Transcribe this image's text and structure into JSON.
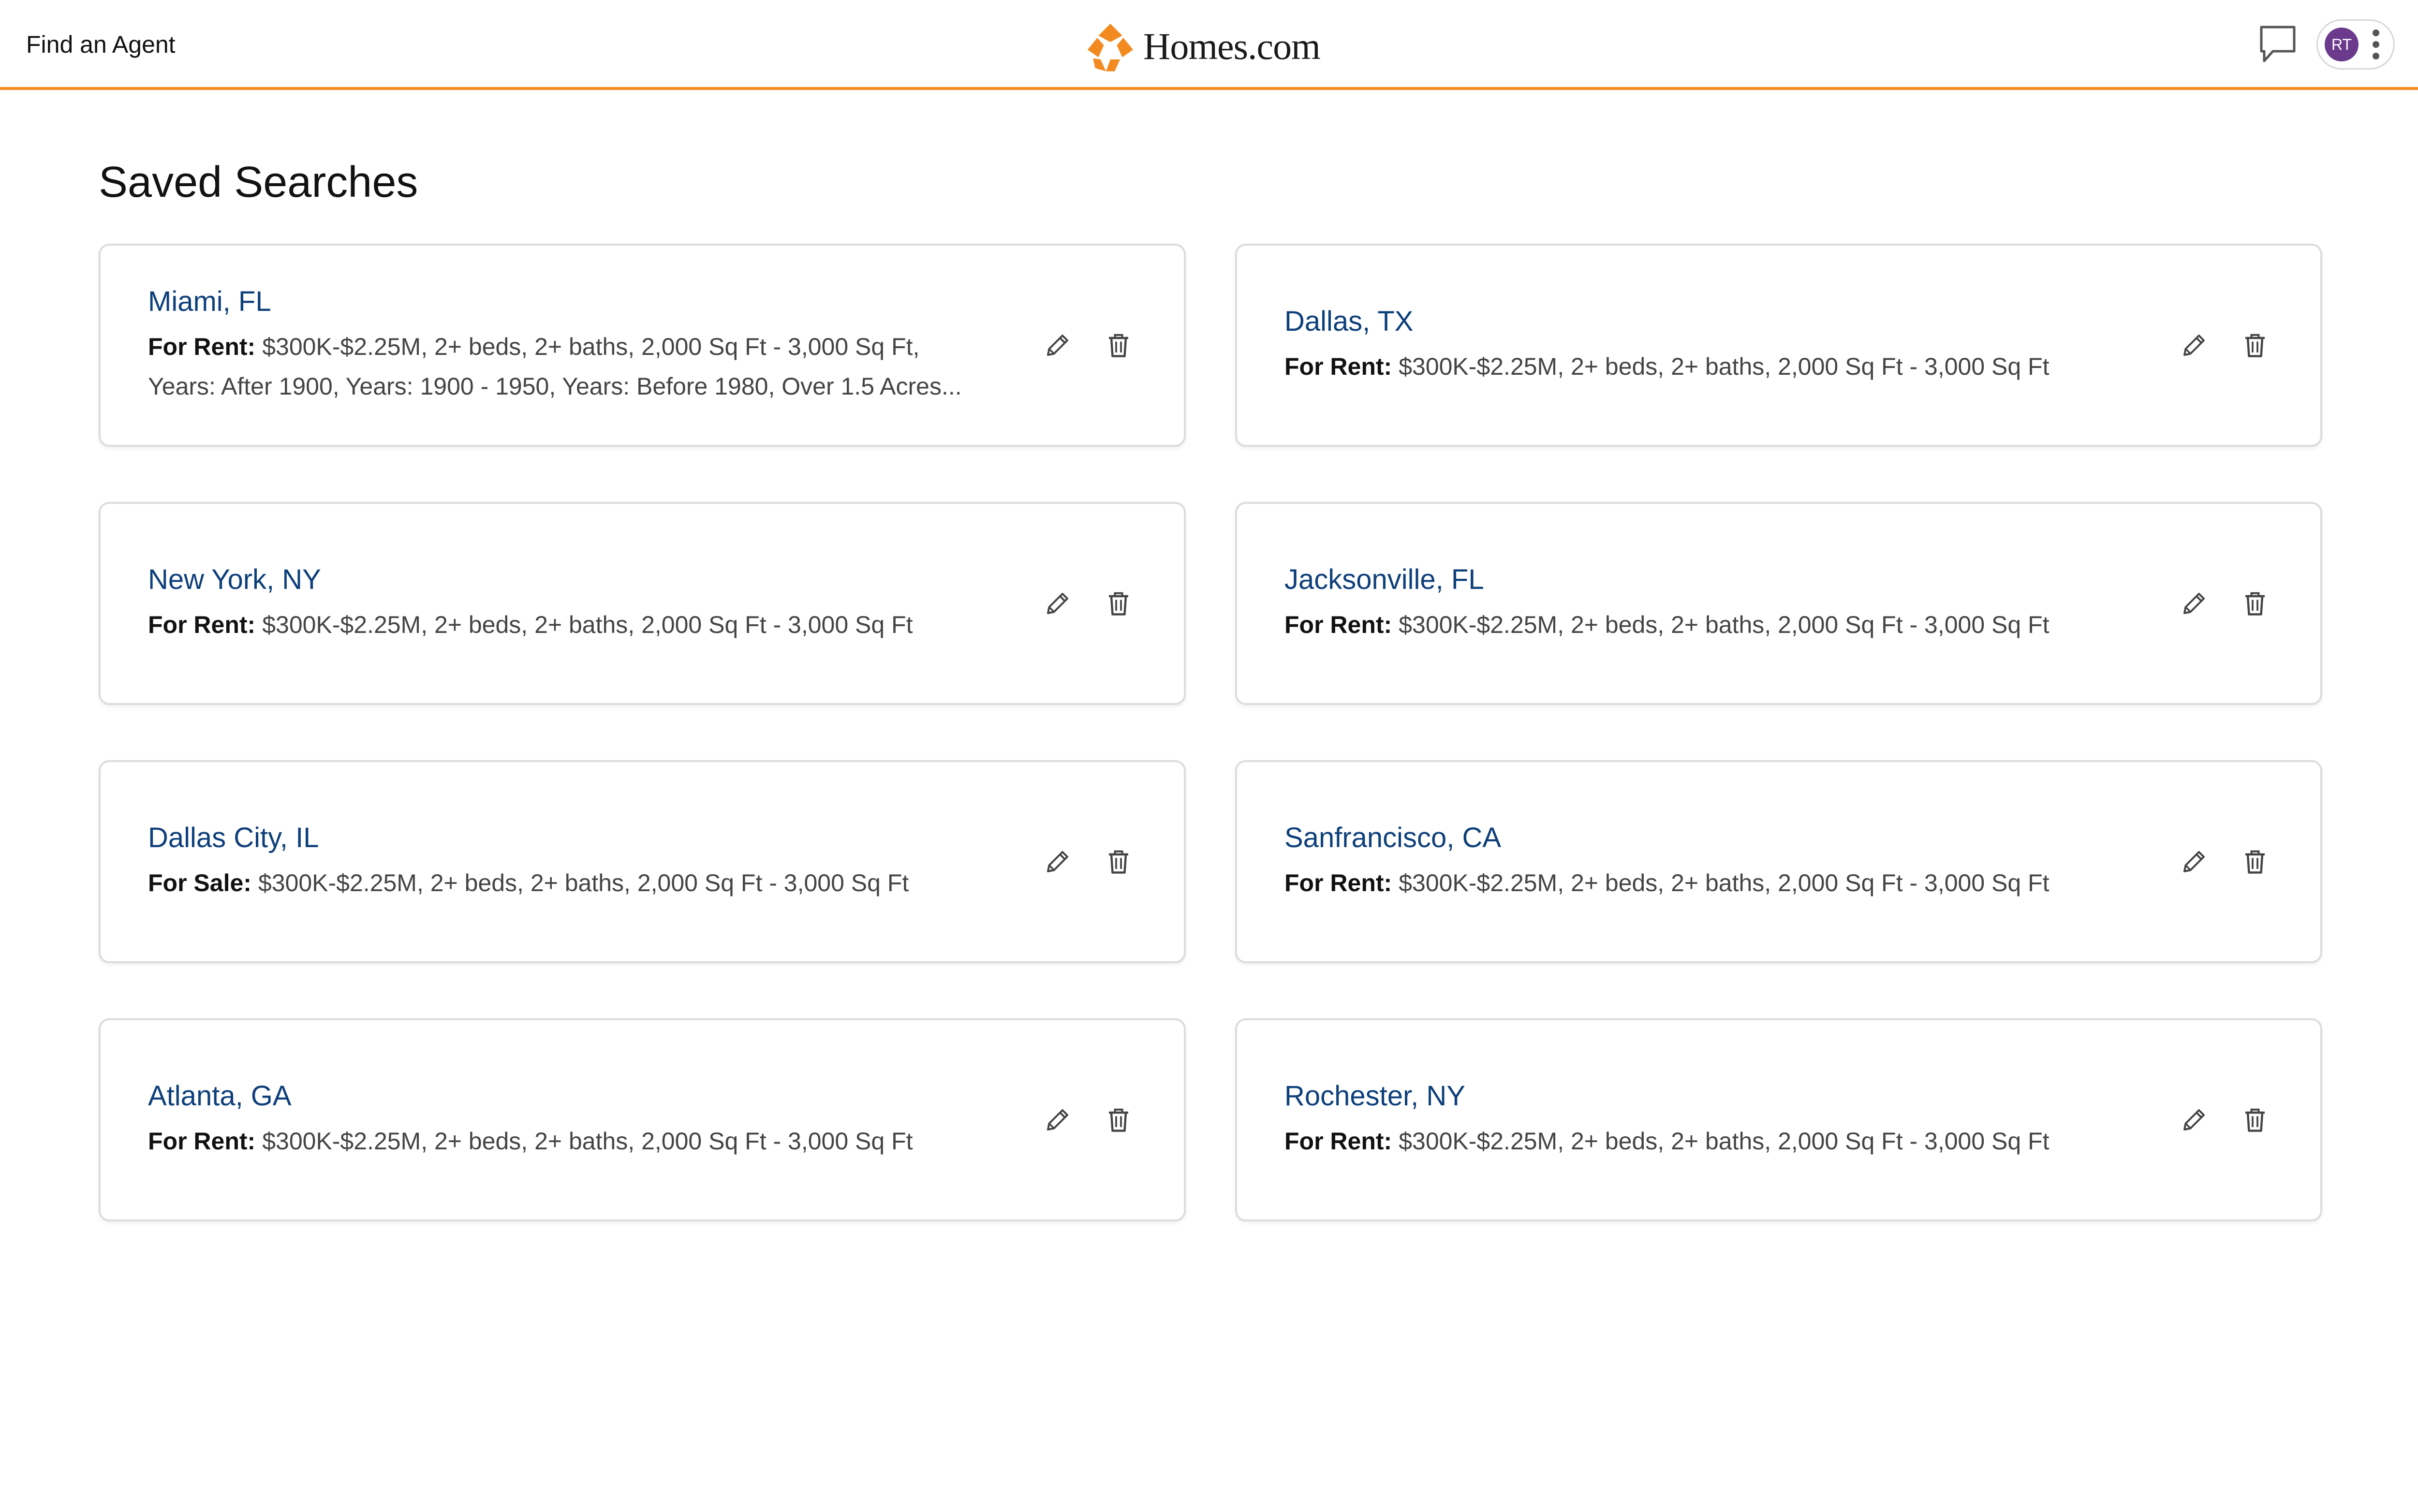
{
  "header": {
    "find_agent_label": "Find an Agent",
    "logo_text": "Homes.com",
    "avatar_initials": "RT",
    "accent_color": "#f28a20",
    "avatar_color": "#6b3a8c"
  },
  "page": {
    "title": "Saved Searches"
  },
  "searches": [
    {
      "location": "Miami, FL",
      "type_label": "For Rent:",
      "criteria": "$300K-$2.25M, 2+ beds, 2+ baths, 2,000 Sq Ft - 3,000 Sq Ft, Years: After 1900, Years: 1900 - 1950, Years: Before 1980, Over 1.5 Acres..."
    },
    {
      "location": "Dallas, TX",
      "type_label": "For Rent:",
      "criteria": "$300K-$2.25M, 2+ beds, 2+ baths, 2,000 Sq Ft - 3,000 Sq Ft"
    },
    {
      "location": "New York, NY",
      "type_label": "For Rent:",
      "criteria": "$300K-$2.25M, 2+ beds, 2+ baths, 2,000 Sq Ft - 3,000 Sq Ft"
    },
    {
      "location": "Jacksonville, FL",
      "type_label": "For Rent:",
      "criteria": "$300K-$2.25M, 2+ beds, 2+ baths, 2,000 Sq Ft - 3,000 Sq Ft"
    },
    {
      "location": "Dallas City, IL",
      "type_label": "For Sale:",
      "criteria": "$300K-$2.25M, 2+ beds, 2+ baths, 2,000 Sq Ft - 3,000 Sq Ft"
    },
    {
      "location": "Sanfrancisco, CA",
      "type_label": "For Rent:",
      "criteria": "$300K-$2.25M, 2+ beds, 2+ baths, 2,000 Sq Ft - 3,000 Sq Ft"
    },
    {
      "location": "Atlanta, GA",
      "type_label": "For Rent:",
      "criteria": "$300K-$2.25M, 2+ beds, 2+ baths, 2,000 Sq Ft - 3,000 Sq Ft"
    },
    {
      "location": "Rochester, NY",
      "type_label": "For Rent:",
      "criteria": "$300K-$2.25M, 2+ beds, 2+ baths, 2,000 Sq Ft - 3,000 Sq Ft"
    }
  ],
  "icons": {
    "edit": "pencil-icon",
    "delete": "trash-icon",
    "messages": "chat-bubble-icon",
    "menu": "kebab-menu-icon",
    "logo": "homes-logo-icon"
  }
}
